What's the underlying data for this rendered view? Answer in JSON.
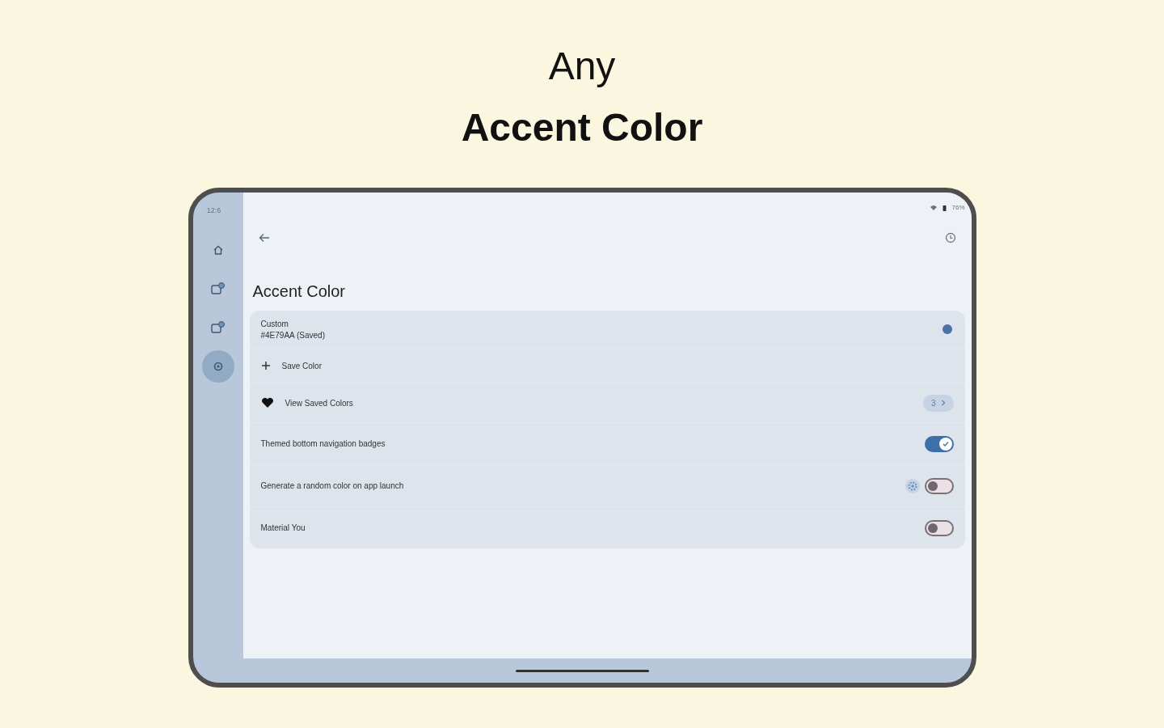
{
  "headline": {
    "line_1": "Any",
    "line_2": "Accent Color"
  },
  "status_bar": {
    "time": "12:6",
    "battery": "76%"
  },
  "rail": [
    {
      "kind": "home",
      "selected": false
    },
    {
      "kind": "shapes",
      "selected": false
    },
    {
      "kind": "shapes",
      "selected": false
    },
    {
      "kind": "settings",
      "selected": true
    }
  ],
  "page_title": "Accent Color",
  "settings": [
    {
      "kind": "color",
      "title": "Custom",
      "value": "#4E79AA (Saved)",
      "color": "#4a72a6"
    },
    {
      "kind": "action",
      "label": "Save Color"
    },
    {
      "kind": "link",
      "label": "View Saved Colors",
      "count": "3"
    },
    {
      "kind": "switch",
      "label": "Themed bottom navigation badges",
      "on": true
    },
    {
      "kind": "switch",
      "label": "Generate a random color on app launch",
      "on": false,
      "gear": true
    },
    {
      "kind": "switch",
      "label": "Material You",
      "on": false
    }
  ]
}
